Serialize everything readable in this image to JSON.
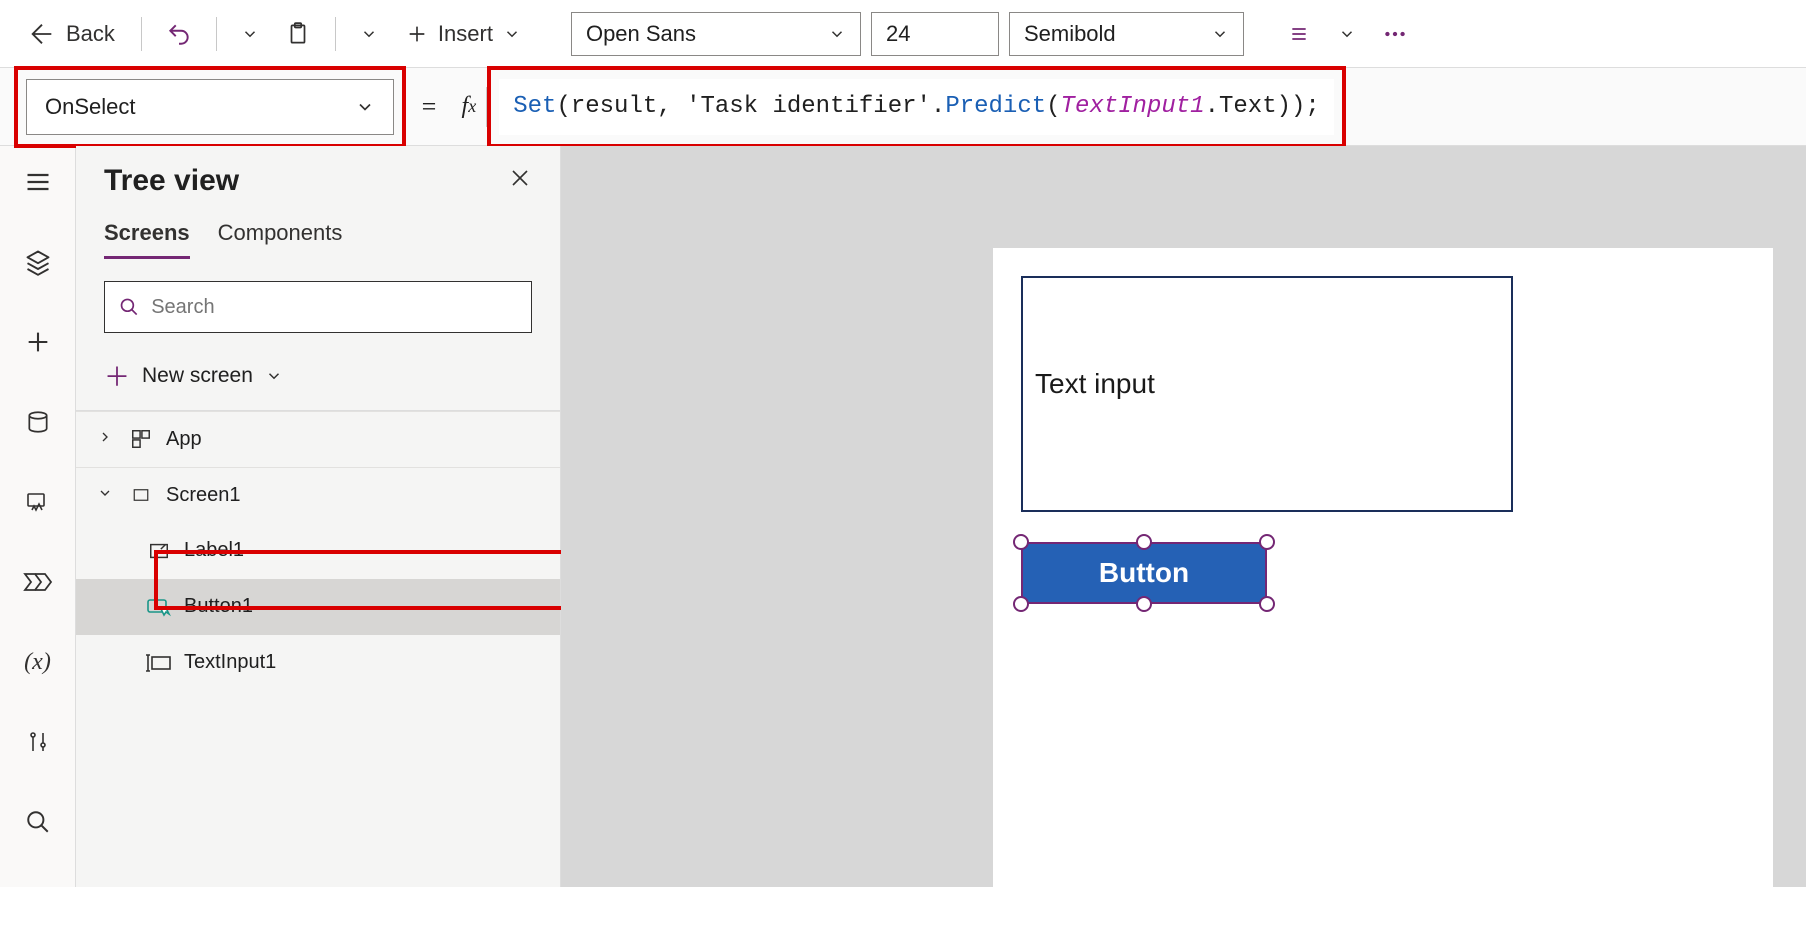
{
  "toolbar": {
    "back_label": "Back",
    "insert_label": "Insert",
    "font": "Open Sans",
    "font_size": "24",
    "font_weight": "Semibold"
  },
  "property": {
    "selected": "OnSelect"
  },
  "formula": {
    "tokens": {
      "set": "Set",
      "p1": "(result, ",
      "task": "'Task identifier'",
      "dot": ".",
      "predict": "Predict",
      "p2": "(",
      "ti": "TextInput1",
      "dot2": ".",
      "text": "Text",
      "p3": "));"
    }
  },
  "tree": {
    "title": "Tree view",
    "tabs": {
      "screens": "Screens",
      "components": "Components"
    },
    "search_placeholder": "Search",
    "new_screen": "New screen",
    "app": "App",
    "screen1": "Screen1",
    "label1": "Label1",
    "button1": "Button1",
    "textinput1": "TextInput1"
  },
  "canvas": {
    "text_input_value": "Text input",
    "button_label": "Button"
  }
}
